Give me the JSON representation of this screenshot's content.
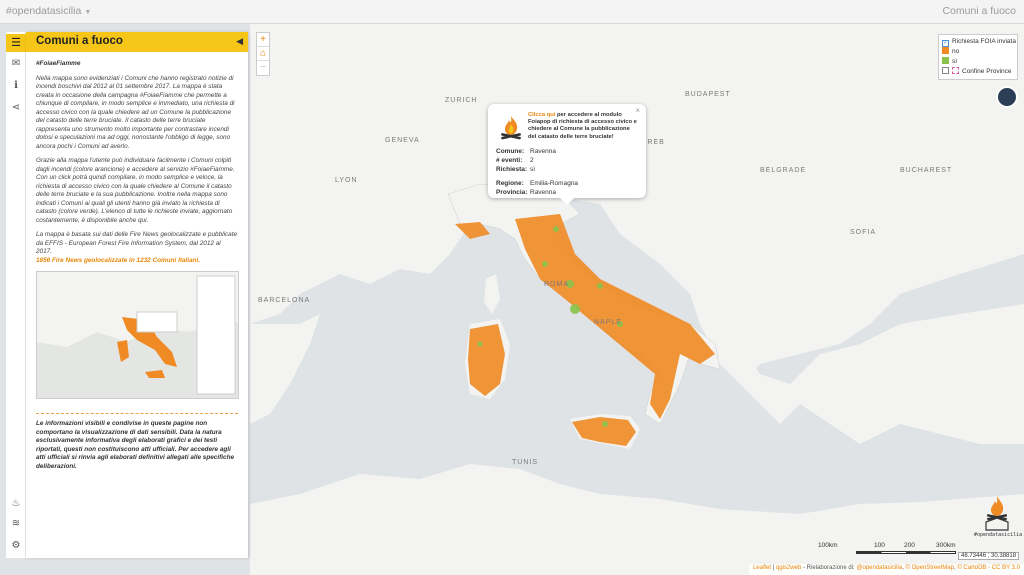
{
  "topbar": {
    "brand": "#opendatasicilia",
    "right_title": "Comuni a fuoco"
  },
  "sidebar": {
    "title": "Comuni a fuoco",
    "hashtag": "#FoiaeFiamme",
    "p1": "Nella mappa sono evidenziati i Comuni che hanno registrato notizie di incendi boschivi dal 2012 al 01 settembre 2017. La mappa è stata creata in occasione della campagna #FoiaeFiamme che permette a chiunque di compilare, in modo semplice e immediato, una richiesta di accesso civico con la quale chiedere ad un Comune la pubblicazione del catasto delle terre bruciate. Il catasto delle terre bruciate rappresenta uno strumento molto importante per contrastare incendi dolosi e speculazioni ma ad oggi, nonostante l'obbligo di legge, sono ancora pochi i Comuni ad averlo.",
    "p2": "Grazie alla mappa l'utente può individuare facilmente i Comuni colpiti dagli incendi (colore arancione) e accedere al servizio #FoiaeFiamme. Con un click potrà quindi compilare, in modo semplice e veloce, la richiesta di accesso civico con la quale chiedere al Comune il catasto delle terre bruciate e la sua pubblicazione. Inoltre nella mappa sono indicati i Comuni ai quali gli utenti hanno già inviato la richiesta di catasto (colore verde). L'elenco di tutte le richieste inviate, aggiornato costantemente, è disponibile anche qui.",
    "p3": "La mappa è basata sui dati delle Fire News geolocalizzate e pubblicate da EFFIS - European Forest Fire Information System, dal 2012 al 2017.",
    "p3_highlight": "1856 Fire News geolocalizzate in 1232 Comuni Italiani.",
    "disclaimer": "Le informazioni visibili e condivise in queste pagine non comportano la visualizzazione di dati sensibili. Data la natura esclusivamente informativa degli elaborati grafici e dei testi riportati, questi non costituiscono atti ufficiali. Per accedere agli atti ufficiali si rinvia agli elaborati definitivi allegati alle specifiche deliberazioni."
  },
  "legend": {
    "title": "Richiesta FOIA inviata",
    "no_label": "no",
    "si_label": "sì",
    "province_label": "Confine Province",
    "no_color": "#f08a24",
    "si_color": "#8bc34a"
  },
  "map_labels": [
    {
      "id": "zurich",
      "text": "ZURICH"
    },
    {
      "id": "geneva",
      "text": "GENEVA"
    },
    {
      "id": "lyon",
      "text": "LYON"
    },
    {
      "id": "barcelona",
      "text": "BARCELONA"
    },
    {
      "id": "roma",
      "text": "ROMA"
    },
    {
      "id": "napoli",
      "text": "NAPLE"
    },
    {
      "id": "budapest",
      "text": "BUDAPEST"
    },
    {
      "id": "belgrade",
      "text": "BELGRADE"
    },
    {
      "id": "sofia",
      "text": "SOFIA"
    },
    {
      "id": "bucharest",
      "text": "BUCHAREST"
    },
    {
      "id": "zagreb",
      "text": "ZAGREB"
    },
    {
      "id": "tunis",
      "text": "TUNIS"
    }
  ],
  "popup": {
    "intro_link": "Clicca qui",
    "intro_text": "per accedere al modulo Foiapop di richiesta di accesso civico e chiedere al Comune la pubblicazione del catasto delle terre bruciate!",
    "comune_label": "Comune:",
    "comune_value": "Ravenna",
    "eventi_label": "# eventi:",
    "eventi_value": "2",
    "richiesta_label": "Richiesta:",
    "richiesta_value": "sì",
    "regione_label": "Regione:",
    "regione_value": "Emilia-Romagna",
    "provincia_label": "Provincia:",
    "provincia_value": "Ravenna"
  },
  "scale": {
    "t0": "100km",
    "t1": "100",
    "t2": "200",
    "t3": "300km"
  },
  "coords": "48.73446 ; 30.38818",
  "attribution": {
    "leaflet": "Leaflet",
    "qgis2web": "qgis2web",
    "rielaborazione": "- Rielaborazione di:",
    "author": "@opendatasicilia",
    "osm": "© OpenStreetMap",
    "carto": "© CartoDB - CC BY 3.0"
  },
  "logo_label": "#opendatasicilia"
}
